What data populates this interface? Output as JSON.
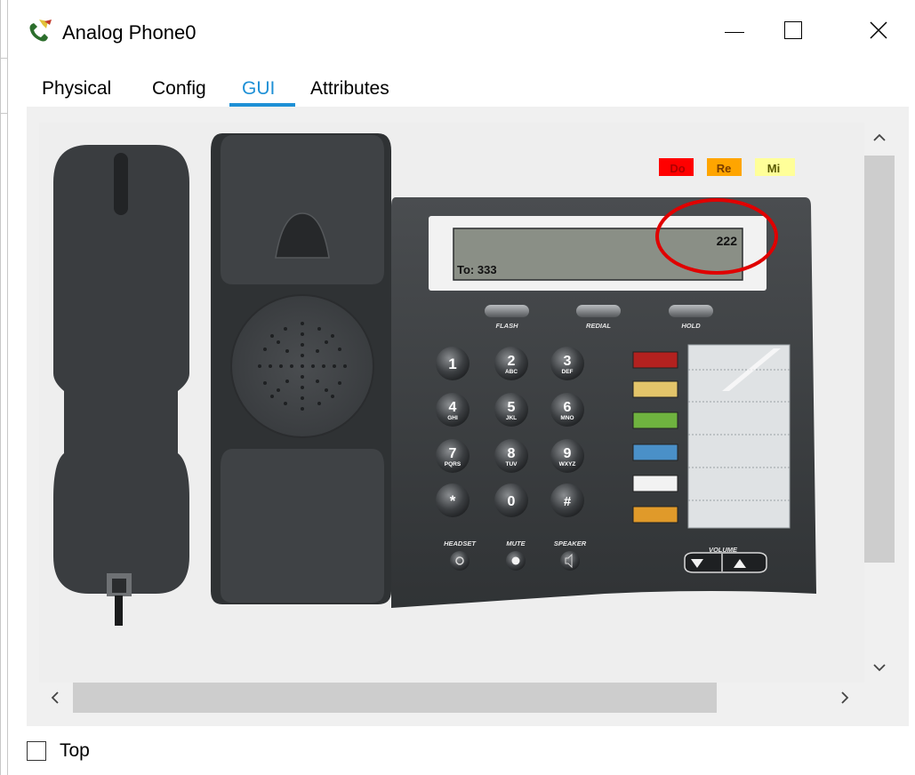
{
  "window": {
    "title": "Analog Phone0",
    "icon": "phone-device-icon"
  },
  "controls": {
    "minimize": "minimize-icon",
    "maximize": "maximize-icon",
    "close": "close-icon"
  },
  "tabs": [
    {
      "label": "Physical",
      "active": false
    },
    {
      "label": "Config",
      "active": false
    },
    {
      "label": "GUI",
      "active": true
    },
    {
      "label": "Attributes",
      "active": false
    }
  ],
  "phone": {
    "ring_tones": [
      "Do",
      "Re",
      "Mi"
    ],
    "lcd": {
      "number": "222",
      "to": "To: 333"
    },
    "soft_keys": [
      "FLASH",
      "REDIAL",
      "HOLD"
    ],
    "keypad": [
      {
        "digit": "1",
        "letters": ""
      },
      {
        "digit": "2",
        "letters": "ABC"
      },
      {
        "digit": "3",
        "letters": "DEF"
      },
      {
        "digit": "4",
        "letters": "GHI"
      },
      {
        "digit": "5",
        "letters": "JKL"
      },
      {
        "digit": "6",
        "letters": "MNO"
      },
      {
        "digit": "7",
        "letters": "PQRS"
      },
      {
        "digit": "8",
        "letters": "TUV"
      },
      {
        "digit": "9",
        "letters": "WXYZ"
      },
      {
        "digit": "*",
        "letters": ""
      },
      {
        "digit": "0",
        "letters": ""
      },
      {
        "digit": "#",
        "letters": ""
      }
    ],
    "function_keys": [
      "HEADSET",
      "MUTE",
      "SPEAKER"
    ],
    "volume_label": "VOLUME",
    "line_key_colors": [
      "#b3211f",
      "#e3c46a",
      "#6fb33f",
      "#4a90c8",
      "#f2f2f2",
      "#e09a2a"
    ],
    "highlight_color": "#e00000"
  },
  "footer": {
    "top_checkbox_label": "Top",
    "top_checked": false
  }
}
